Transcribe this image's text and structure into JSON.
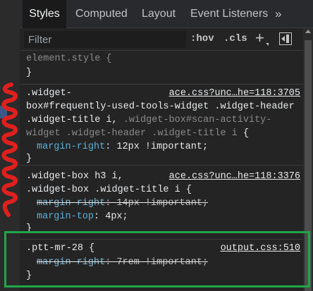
{
  "tabs": [
    {
      "label": "Styles"
    },
    {
      "label": "Computed"
    },
    {
      "label": "Layout"
    },
    {
      "label": "Event Listeners"
    },
    {
      "label": "»"
    }
  ],
  "toolbar": {
    "filter_placeholder": "Filter",
    "hov_label": ":hov",
    "cls_label": ".cls",
    "new_rule_label": "+"
  },
  "rules": [
    {
      "selector": "element.style {",
      "close": "}"
    },
    {
      "selector_lines": [
        ".widget-",
        "box#frequently-used-tools-widget .widget-header",
        ".widget-title i, "
      ],
      "selector_dim_1": ".widget-box#scan-activity-",
      "selector_dim_2": "widget .widget-header .widget-title i",
      "selector_end": " {",
      "source": "ace.css?unc…he=118:3705",
      "declarations": [
        {
          "property": "margin-right",
          "value": "12px !important",
          "overridden": false
        }
      ],
      "close": "}"
    },
    {
      "selector_lines": [
        ".widget-box h3 i,",
        ".widget-box .widget-title i {"
      ],
      "source": "ace.css?unc…he=118:3376",
      "declarations": [
        {
          "property": "margin-right",
          "value": "14px !important",
          "overridden": true
        },
        {
          "property": "margin-top",
          "value": "4px",
          "overridden": false
        }
      ],
      "close": "}"
    },
    {
      "selector": ".ptt-mr-28 {",
      "source": "output.css:510",
      "declarations": [
        {
          "property": "margin-right",
          "value": "7rem !important",
          "overridden": true
        }
      ],
      "close": "}"
    }
  ],
  "annotation_colors": {
    "highlight_box": "#1fa64a",
    "scribble": "#e0201e"
  },
  "colors": {
    "panel_bg": "#242424",
    "property_name": "#5db0d7",
    "text": "#e8eaed"
  }
}
